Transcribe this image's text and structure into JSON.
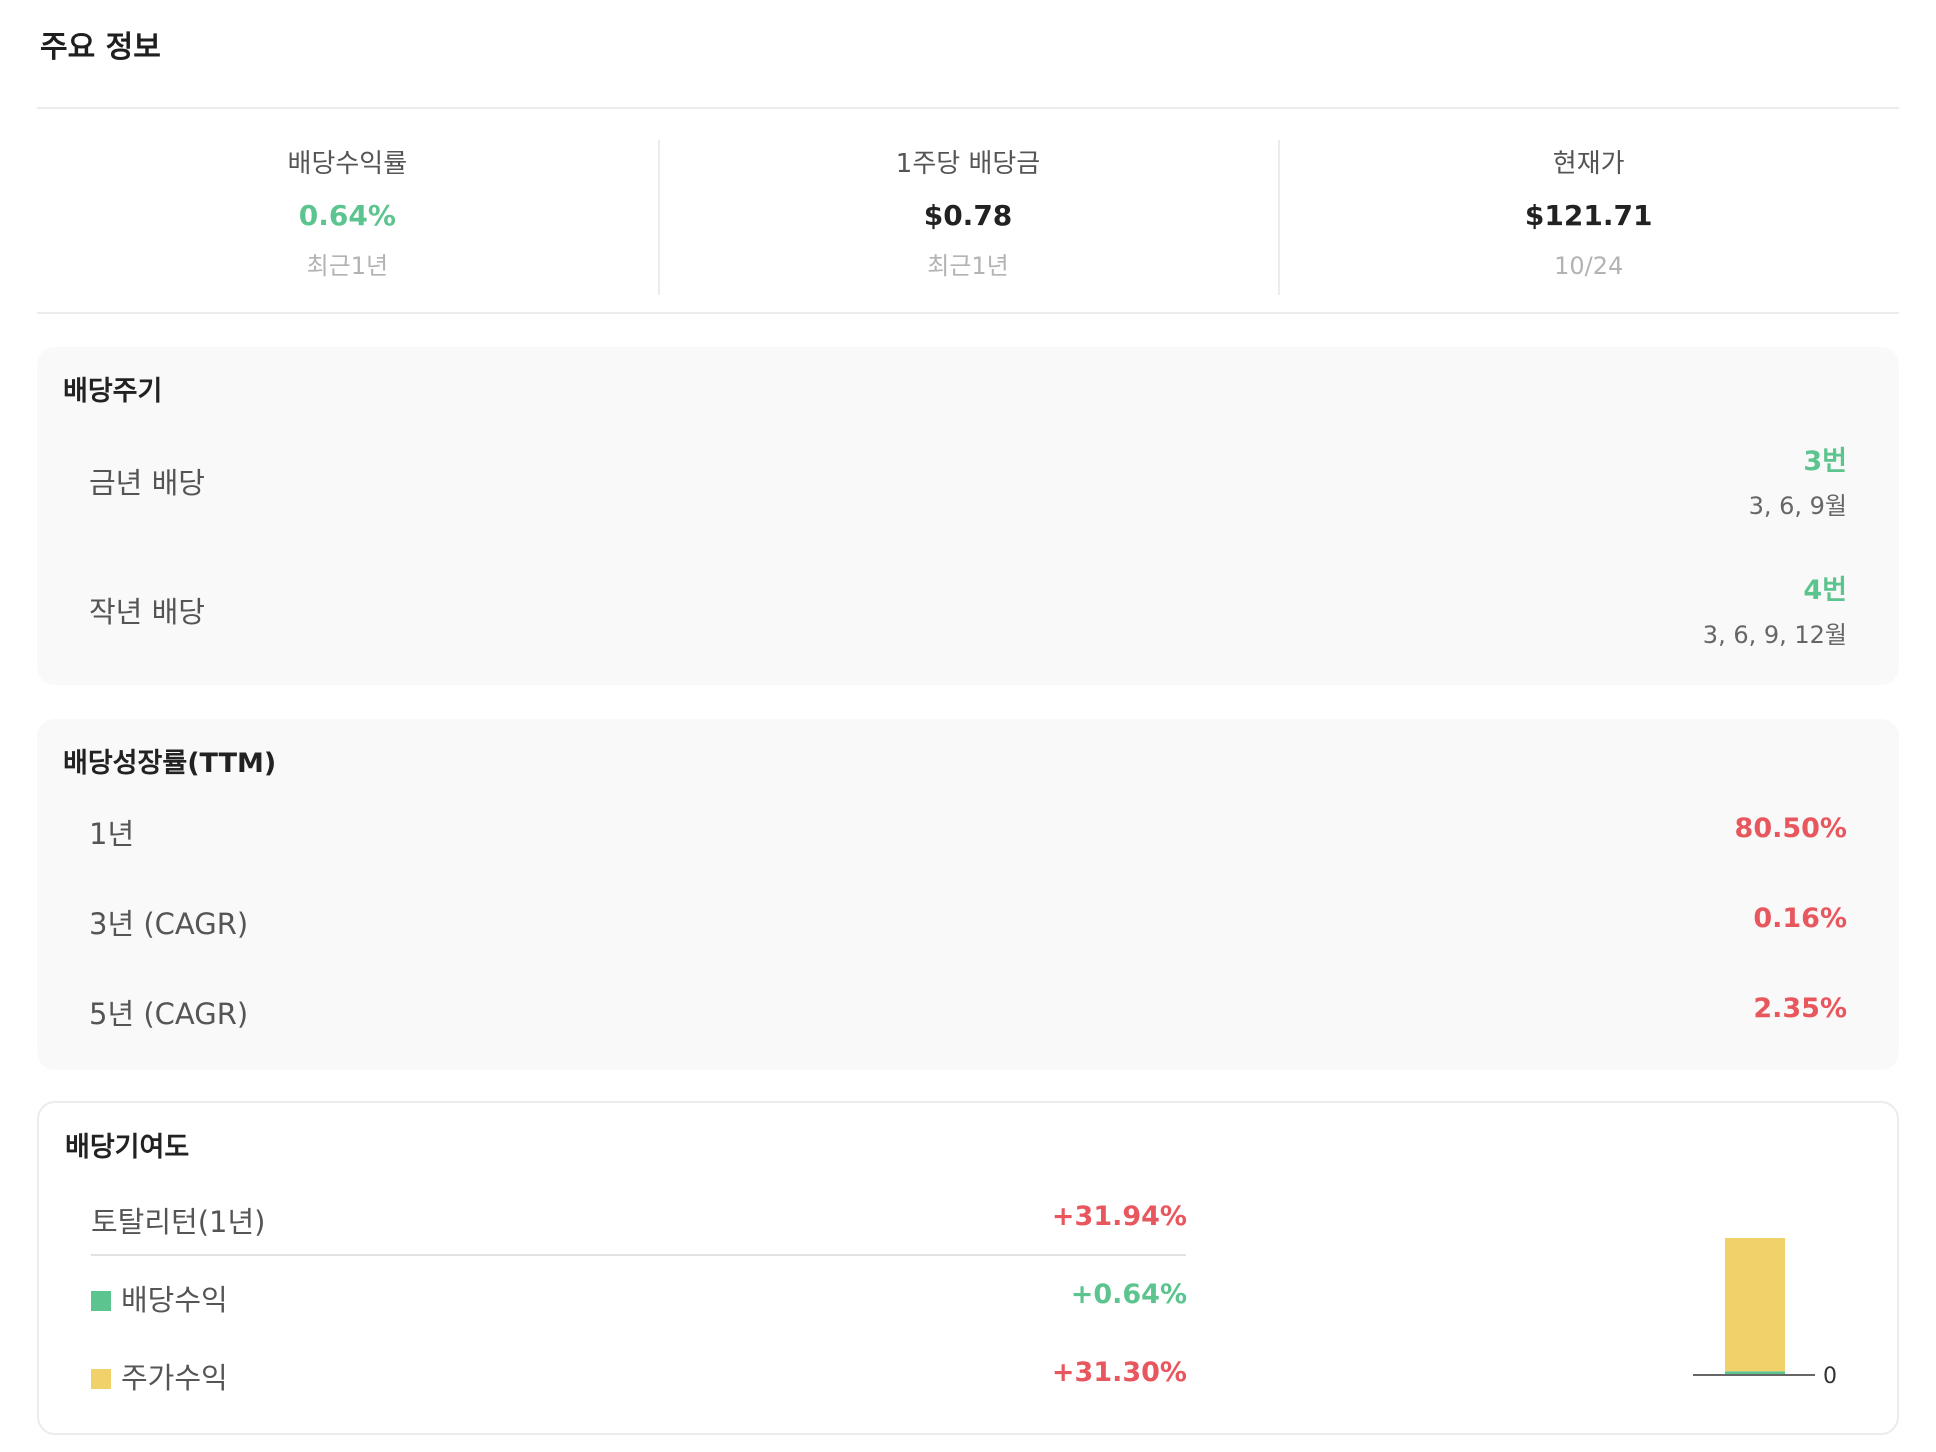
{
  "header": {
    "title": "주요 정보"
  },
  "summary": [
    {
      "label": "배당수익률",
      "value": "0.64%",
      "sub": "최근1년",
      "accent": "green"
    },
    {
      "label": "1주당 배당금",
      "value": "$0.78",
      "sub": "최근1년",
      "accent": "dark"
    },
    {
      "label": "현재가",
      "value": "$121.71",
      "sub": "10/24",
      "accent": "dark"
    }
  ],
  "dividend_cycle": {
    "title": "배당주기",
    "rows": [
      {
        "label": "금년 배당",
        "count": "3번",
        "months": "3, 6, 9월"
      },
      {
        "label": "작년 배당",
        "count": "4번",
        "months": "3, 6, 9, 12월"
      }
    ]
  },
  "dividend_growth": {
    "title": "배당성장률(TTM)",
    "rows": [
      {
        "label": "1년",
        "value": "80.50%"
      },
      {
        "label": "3년 (CAGR)",
        "value": "0.16%"
      },
      {
        "label": "5년 (CAGR)",
        "value": "2.35%"
      }
    ]
  },
  "contribution": {
    "title": "배당기여도",
    "total_label": "토탈리턴(1년)",
    "total_value": "+31.94%",
    "dividend_label": "배당수익",
    "dividend_value": "+0.64%",
    "price_label": "주가수익",
    "price_value": "+31.30%",
    "colors": {
      "dividend": "#5cc48e",
      "price": "#f1d26a",
      "positive": "#e8575e"
    }
  },
  "chart_data": {
    "type": "bar",
    "stacked": true,
    "categories": [
      ""
    ],
    "series": [
      {
        "name": "배당수익",
        "values": [
          0.64
        ],
        "color": "#5cc48e"
      },
      {
        "name": "주가수익",
        "values": [
          31.3
        ],
        "color": "#f1d26a"
      }
    ],
    "ylim": [
      0,
      31.94
    ],
    "tick_labels": [
      "0"
    ]
  }
}
